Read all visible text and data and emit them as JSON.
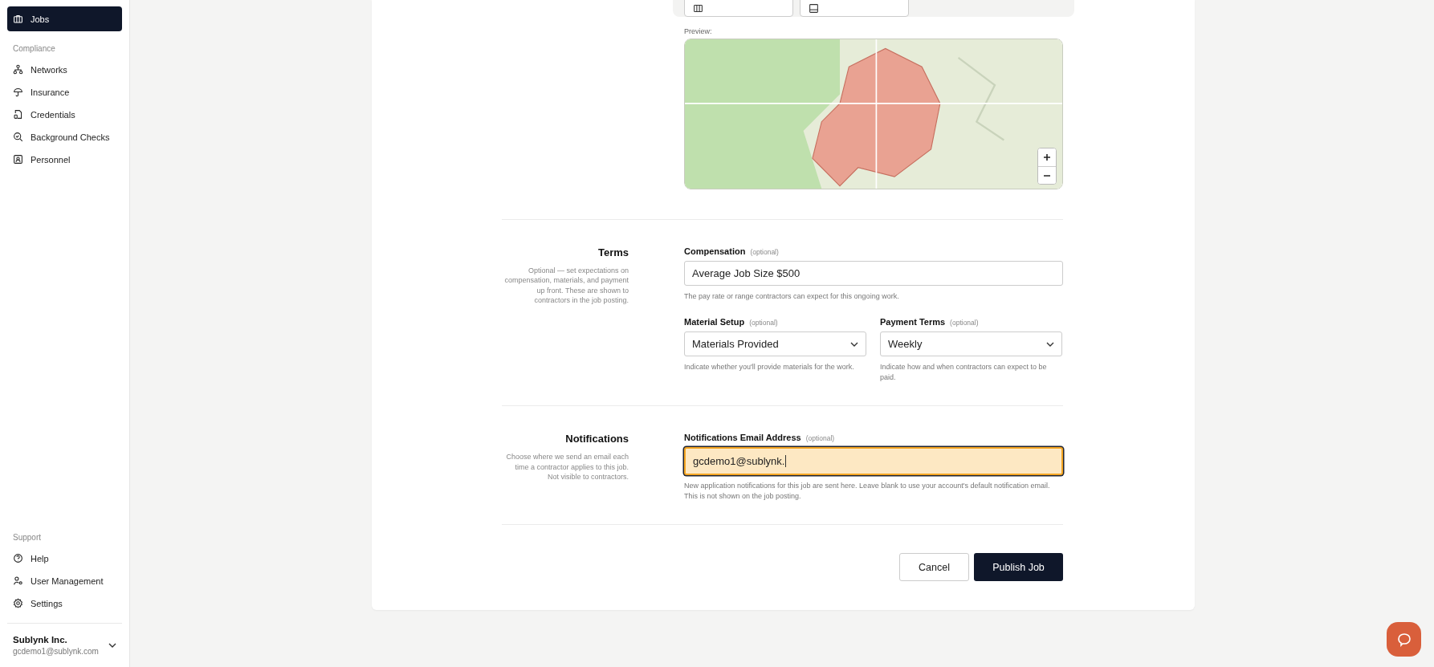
{
  "sidebar": {
    "items": [
      {
        "label": "Jobs",
        "kind": "briefcase",
        "selected": true
      }
    ],
    "sections": [
      {
        "title": "Compliance",
        "items": [
          {
            "label": "Networks",
            "kind": "network",
            "selected": false
          },
          {
            "label": "Insurance",
            "kind": "umbrella",
            "selected": false
          },
          {
            "label": "Credentials",
            "kind": "document",
            "selected": false
          },
          {
            "label": "Background Checks",
            "kind": "search",
            "selected": false
          },
          {
            "label": "Personnel",
            "kind": "badge",
            "selected": false
          }
        ]
      }
    ],
    "support": {
      "title": "Support",
      "items": [
        {
          "label": "Help",
          "kind": "help",
          "selected": false
        },
        {
          "label": "User Management",
          "kind": "users",
          "selected": false
        },
        {
          "label": "Settings",
          "kind": "settings",
          "selected": false
        }
      ]
    },
    "account": {
      "name": "Sublynk Inc.",
      "email": "gcdemo1@sublynk.com"
    }
  },
  "service_area": {
    "preview_label": "Preview:"
  },
  "sections": [
    {
      "title": "Terms",
      "description": "Optional — set expectations on compensation, materials, and payment up front. These are shown to contractors in the job posting.",
      "fields": [
        {
          "kind": "text",
          "label": "Compensation",
          "optional": "(optional)",
          "value": "Average Job Size $500",
          "help": "The pay rate or range contractors can expect for this ongoing work.",
          "focused": false
        },
        {
          "kind": "select",
          "label": "Material Setup",
          "optional": "(optional)",
          "value": "Materials Provided",
          "help": "Indicate whether you'll provide materials for the work.",
          "focused": false
        },
        {
          "kind": "select",
          "label": "Payment Terms",
          "optional": "(optional)",
          "value": "Weekly",
          "help": "Indicate how and when contractors can expect to be paid.",
          "focused": false
        }
      ]
    },
    {
      "title": "Notifications",
      "description": "Choose where we send an email each time a contractor applies to this job. Not visible to contractors.",
      "fields": [
        {
          "kind": "text",
          "label": "Notifications Email Address",
          "optional": "(optional)",
          "value": "gcdemo1@sublynk.",
          "help": "New application notifications for this job are sent here. Leave blank to use your account's default notification email. This is not shown on the job posting.",
          "focused": true
        }
      ]
    }
  ],
  "actions": {
    "cancel": "Cancel",
    "publish": "Publish Job"
  }
}
